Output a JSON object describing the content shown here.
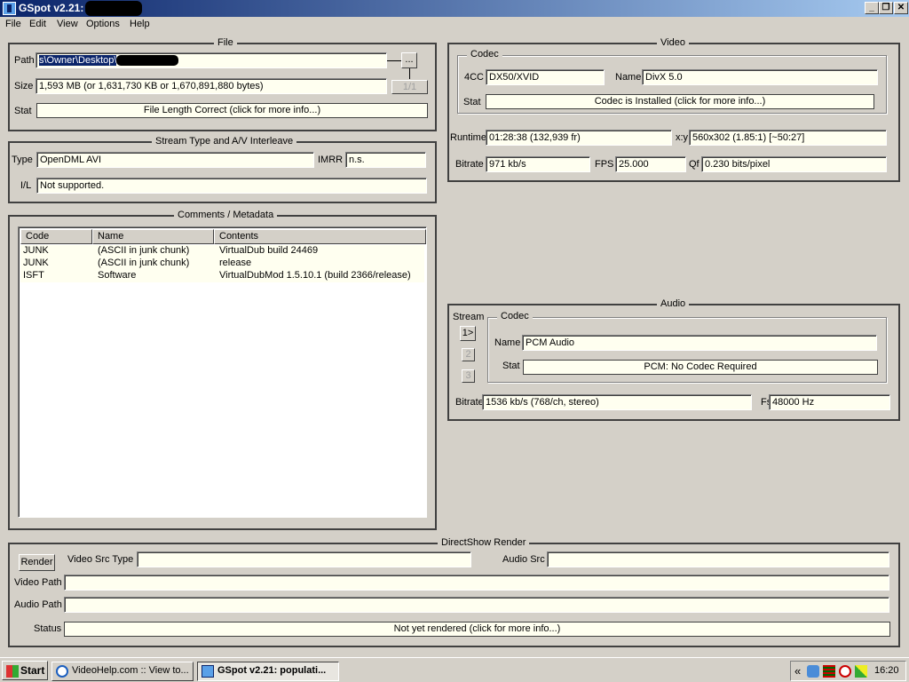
{
  "window": {
    "title": "GSpot v2.21:",
    "controls": {
      "minimize": "_",
      "maximize": "❐",
      "close": "✕"
    }
  },
  "menu": [
    "File",
    "Edit",
    "View",
    "Options",
    "Help"
  ],
  "file": {
    "legend": "File",
    "path_label": "Path",
    "path_value": "s\\Owner\\Desktop\\",
    "browse_label": "...",
    "size_label": "Size",
    "size_value": "1,593 MB (or 1,631,730 KB or 1,670,891,880 bytes)",
    "counter": "1/1",
    "stat_label": "Stat",
    "stat_value": "File Length Correct (click for more info...)"
  },
  "stream": {
    "legend": "Stream Type and A/V Interleave",
    "type_label": "Type",
    "type_value": "OpenDML AVI",
    "imrr_label": "IMRR",
    "imrr_value": "n.s.",
    "il_label": "I/L",
    "il_value": "Not supported."
  },
  "comments": {
    "legend": "Comments / Metadata",
    "columns": [
      "Code",
      "Name",
      "Contents"
    ],
    "rows": [
      [
        "JUNK",
        "(ASCII in junk chunk)",
        "VirtualDub build 24469"
      ],
      [
        "JUNK",
        "(ASCII in junk chunk)",
        "release"
      ],
      [
        "ISFT",
        "Software",
        "VirtualDubMod 1.5.10.1 (build 2366/release)"
      ]
    ]
  },
  "video": {
    "legend": "Video",
    "codec_legend": "Codec",
    "fourcc_label": "4CC",
    "fourcc_value": "DX50/XVID",
    "name_label": "Name",
    "name_value": "DivX 5.0",
    "stat_label": "Stat",
    "stat_value": "Codec is Installed (click for more info...)",
    "runtime_label": "Runtime",
    "runtime_value": "01:28:38 (132,939 fr)",
    "xy_label": "x:y",
    "xy_value": "560x302 (1.85:1) [~50:27]",
    "bitrate_label": "Bitrate",
    "bitrate_value": "971 kb/s",
    "fps_label": "FPS",
    "fps_value": "25.000",
    "qf_label": "Qf",
    "qf_value": "0.230 bits/pixel"
  },
  "audio": {
    "legend": "Audio",
    "stream_label": "Stream",
    "stream_buttons": [
      "1>",
      "2",
      "3"
    ],
    "codec_legend": "Codec",
    "name_label": "Name",
    "name_value": "PCM Audio",
    "stat_label": "Stat",
    "stat_value": "PCM: No Codec Required",
    "bitrate_label": "Bitrate",
    "bitrate_value": "1536 kb/s (768/ch, stereo)",
    "fs_label": "Fs",
    "fs_value": "48000 Hz"
  },
  "directshow": {
    "legend": "DirectShow Render",
    "render_button": "Render",
    "video_src_type_label": "Video Src Type",
    "video_src_type_value": "",
    "audio_src_label": "Audio Src",
    "audio_src_value": "",
    "video_path_label": "Video Path",
    "video_path_value": "",
    "audio_path_label": "Audio Path",
    "audio_path_value": "",
    "status_label": "Status",
    "status_value": "Not yet rendered (click for more info...)"
  },
  "taskbar": {
    "start": "Start",
    "tasks": [
      "VideoHelp.com :: View to...",
      "GSpot v2.21: populati..."
    ],
    "tray_arrow": "«",
    "clock": "16:20"
  }
}
